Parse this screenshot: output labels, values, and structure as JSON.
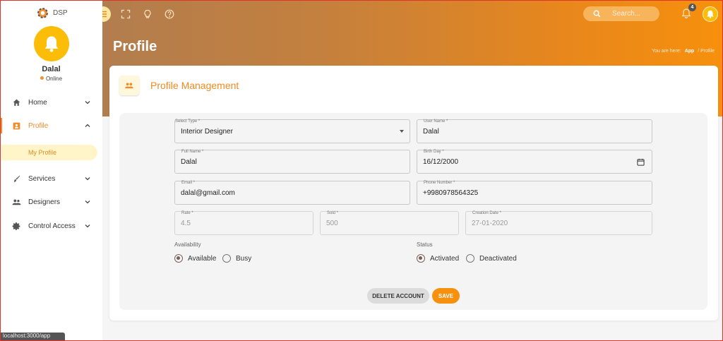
{
  "app": {
    "brand": "DSP"
  },
  "user": {
    "name": "Dalal",
    "status": "Online"
  },
  "nav": {
    "home": "Home",
    "profile": "Profile",
    "my_profile": "My Profile",
    "services": "Services",
    "designers": "Designers",
    "control_access": "Control Access"
  },
  "header": {
    "search_placeholder": "Search...",
    "notifications_count": "4",
    "page_title": "Profile",
    "breadcrumb_prefix": "You are here:",
    "breadcrumb_app": "App",
    "breadcrumb_sep": "/",
    "breadcrumb_current": "Profile"
  },
  "card": {
    "title": "Profile Management"
  },
  "form": {
    "select_type": {
      "label": "Select Type *",
      "value": "Interior Designer"
    },
    "user_name": {
      "label": "User Name *",
      "value": "Dalal"
    },
    "full_name": {
      "label": "Full Name *",
      "value": "Dalal"
    },
    "birth_day": {
      "label": "Birth Day *",
      "value": "16/12/2000"
    },
    "email": {
      "label": "Email *",
      "value": "dalal@gmail.com"
    },
    "phone": {
      "label": "Phone Number *",
      "value": "+9980978564325"
    },
    "rate": {
      "label": "Rate *",
      "value": "4.5"
    },
    "sold": {
      "label": "Sold *",
      "value": "500"
    },
    "creation_date": {
      "label": "Creation Date *",
      "value": "27-01-2020"
    },
    "availability": {
      "label": "Availability",
      "options": [
        "Available",
        "Busy"
      ],
      "selected": "Available"
    },
    "status": {
      "label": "Status",
      "options": [
        "Activated",
        "Deactivated"
      ],
      "selected": "Activated"
    },
    "delete_label": "DELETE ACCOUNT",
    "save_label": "SAVE"
  },
  "browser": {
    "status_url": "localhost:3000/app"
  },
  "colors": {
    "accent": "#f7900c",
    "avatar": "#fbbd08",
    "active_bg": "#fff5c8"
  }
}
